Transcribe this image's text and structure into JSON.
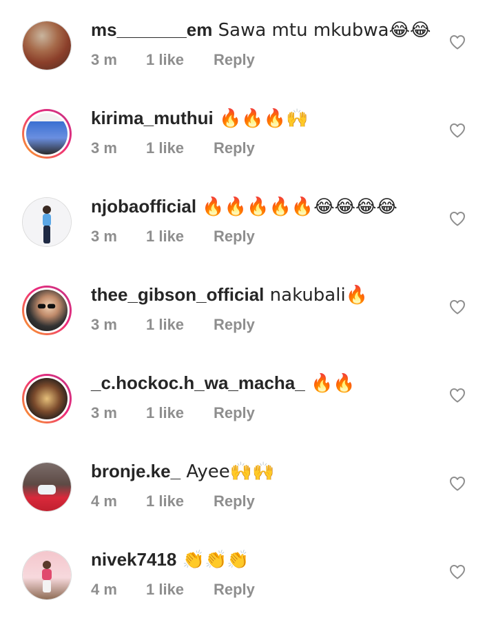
{
  "comments": [
    {
      "username": "ms_______em",
      "text": " Sawa mtu mkubwa😂😂",
      "time": "3 m",
      "likes": "1 like",
      "reply": "Reply"
    },
    {
      "username": "kirima_muthui",
      "text": " 🔥🔥🔥🙌",
      "time": "3 m",
      "likes": "1 like",
      "reply": "Reply"
    },
    {
      "username": "njobaofficial",
      "text": " 🔥🔥🔥🔥🔥😂😂😂😂",
      "time": "3 m",
      "likes": "1 like",
      "reply": "Reply"
    },
    {
      "username": "thee_gibson_official",
      "text": " nakubali🔥",
      "time": "3 m",
      "likes": "1 like",
      "reply": "Reply"
    },
    {
      "username": "_c.hockoc.h_wa_macha_",
      "text": " 🔥🔥",
      "time": "3 m",
      "likes": "1 like",
      "reply": "Reply"
    },
    {
      "username": "bronje.ke_",
      "text": " Ayee🙌🙌",
      "time": "4 m",
      "likes": "1 like",
      "reply": "Reply"
    },
    {
      "username": "nivek7418",
      "text": " 👏👏👏",
      "time": "4 m",
      "likes": "1 like",
      "reply": "Reply"
    }
  ],
  "icons": {
    "like": "heart-outline-icon"
  },
  "colors": {
    "text": "#262626",
    "meta": "#8e8e8e",
    "story_ring_start": "#f9a825",
    "story_ring_end": "#c13584"
  }
}
